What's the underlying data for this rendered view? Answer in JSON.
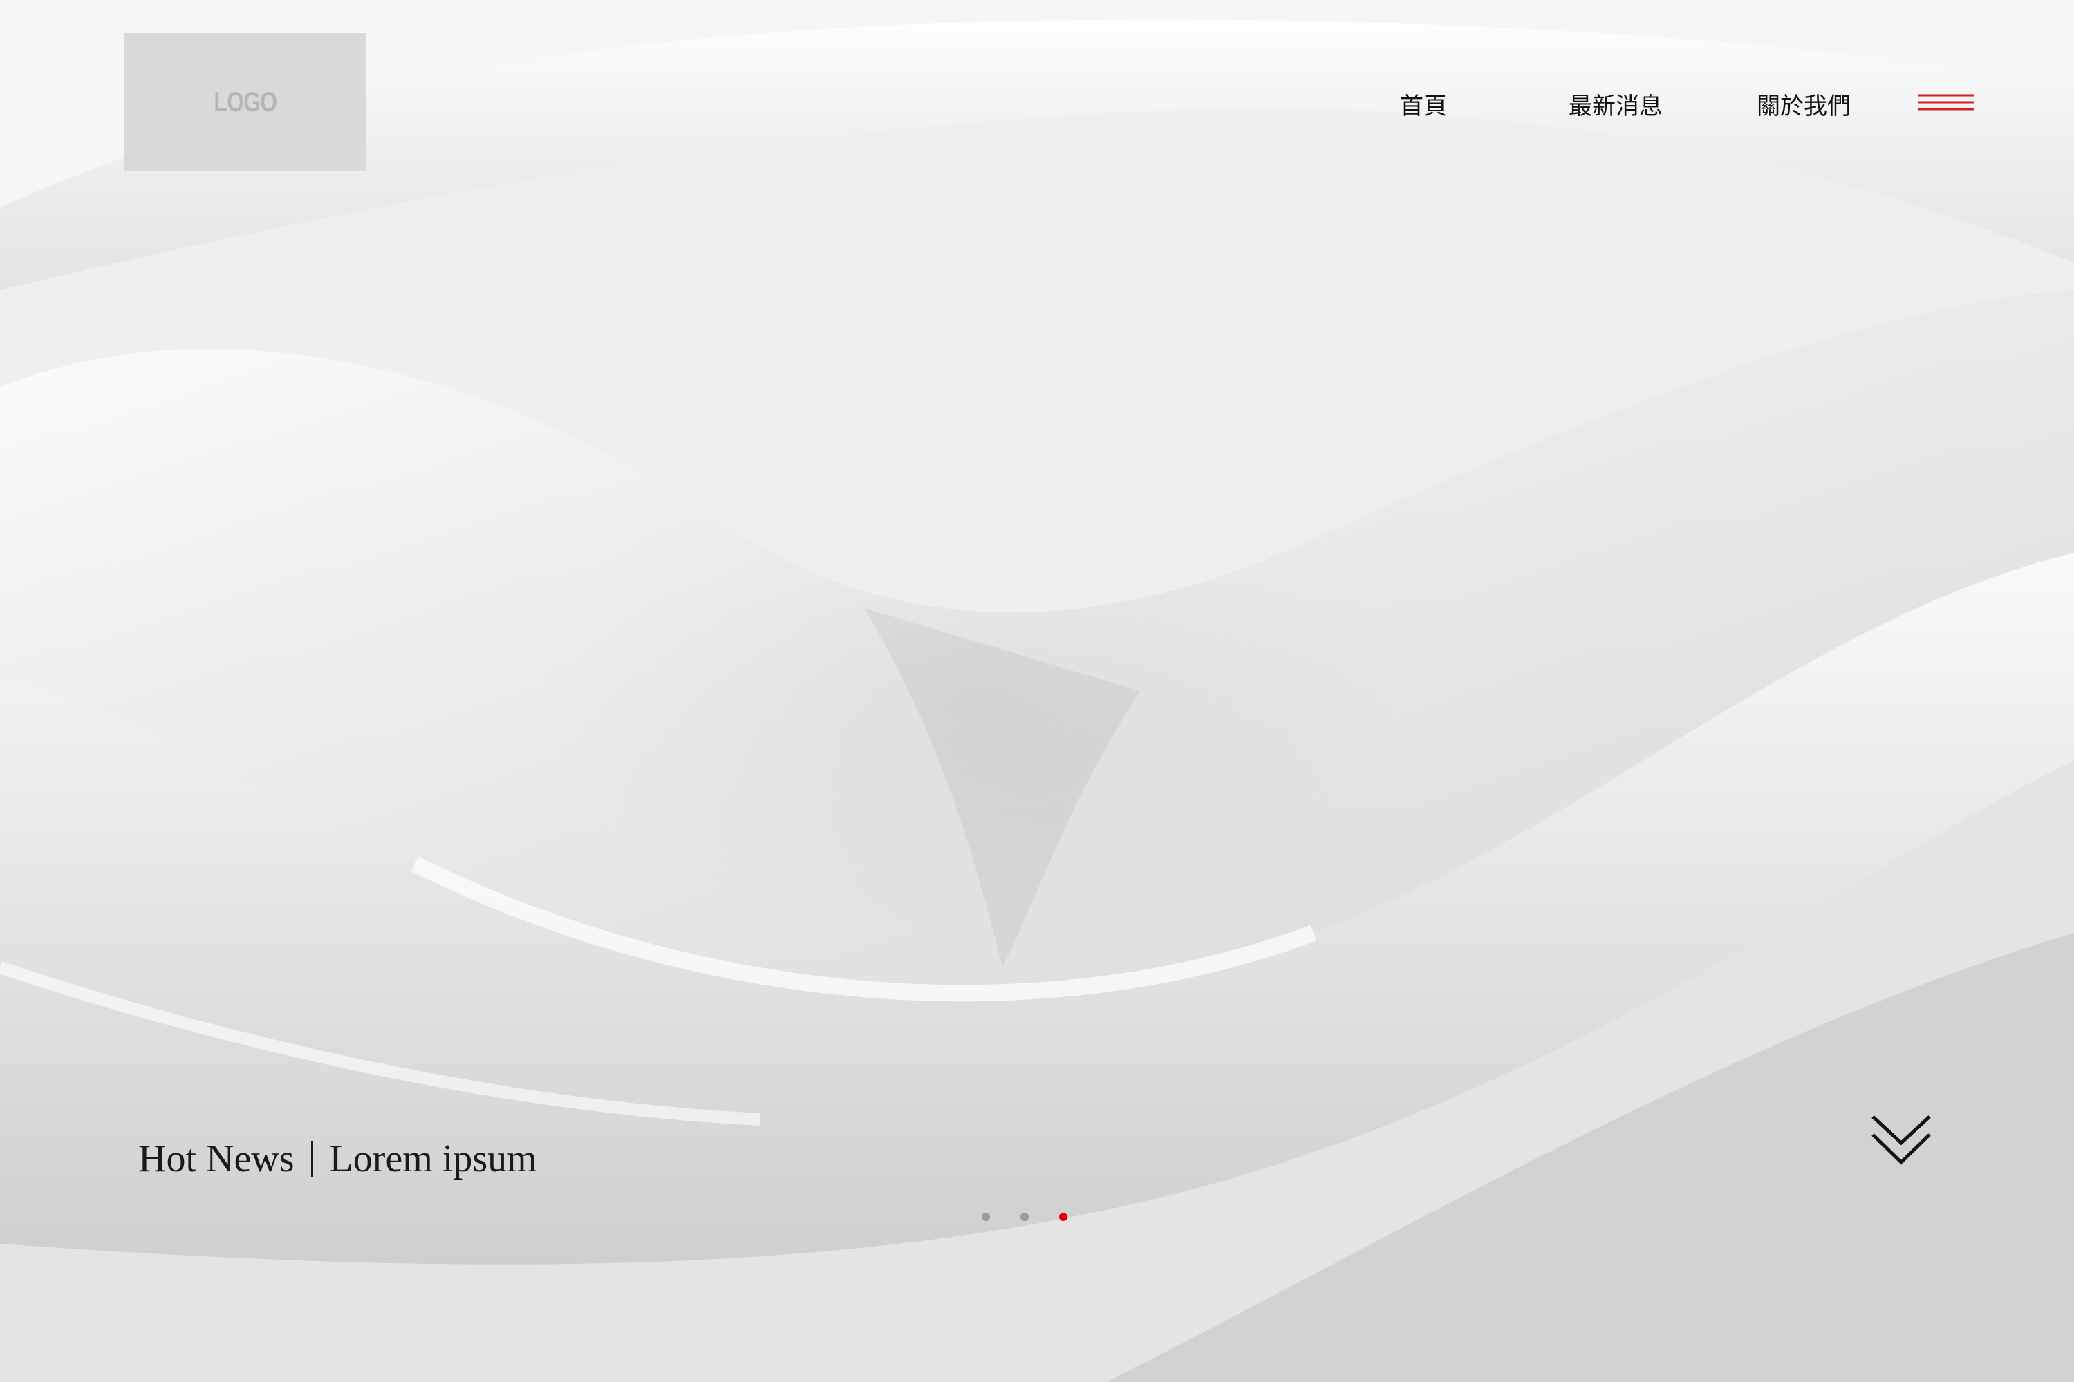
{
  "header": {
    "logo_text": "LOGO",
    "nav": [
      {
        "label": "首頁"
      },
      {
        "label": "最新消息"
      },
      {
        "label": "關於我們"
      }
    ],
    "menu_icon": "hamburger-menu-icon",
    "menu_color": "#d42020"
  },
  "hero": {
    "news_tag": "Hot News",
    "news_text": "Lorem ipsum",
    "slides": {
      "count": 3,
      "active_index": 2,
      "active_color": "#e00000",
      "inactive_color": "#9a9a9a"
    },
    "scroll_icon": "double-chevron-down-icon"
  }
}
